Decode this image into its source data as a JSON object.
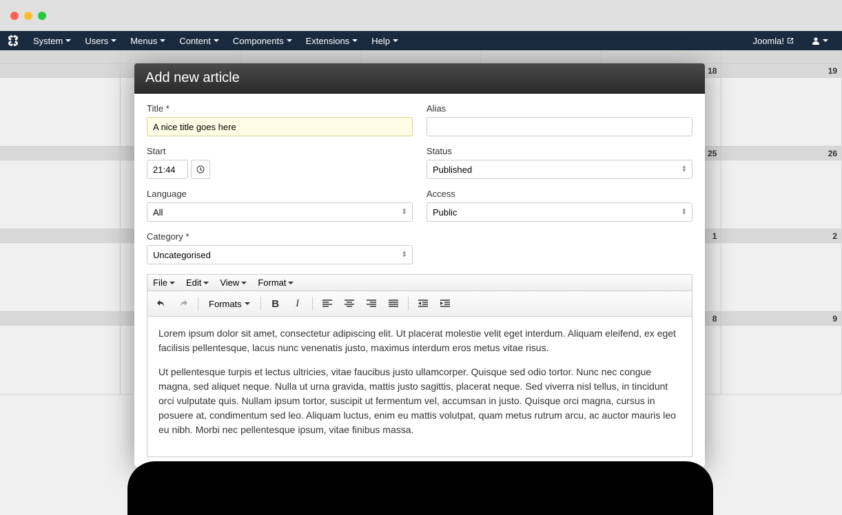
{
  "nav": {
    "items": [
      "System",
      "Users",
      "Menus",
      "Content",
      "Components",
      "Extensions",
      "Help"
    ],
    "brand": "Joomla!"
  },
  "calendar": {
    "rows": [
      [
        "",
        "",
        "",
        "",
        "",
        "",
        ""
      ],
      [
        "",
        "",
        "",
        "",
        "",
        "18",
        "19"
      ],
      [
        "",
        "",
        "",
        "",
        "",
        "25",
        "26"
      ],
      [
        "",
        "",
        "",
        "",
        "",
        "1",
        "2"
      ],
      [
        "",
        "",
        "",
        "",
        "",
        "8",
        "9"
      ]
    ]
  },
  "modal": {
    "title": "Add new article",
    "fields": {
      "title_label": "Title *",
      "title_value": "A nice title goes here",
      "alias_label": "Alias",
      "alias_value": "",
      "start_label": "Start",
      "start_value": "21:44",
      "status_label": "Status",
      "status_value": "Published",
      "language_label": "Language",
      "language_value": "All",
      "access_label": "Access",
      "access_value": "Public",
      "category_label": "Category *",
      "category_value": "Uncategorised"
    },
    "editor": {
      "menus": [
        "File",
        "Edit",
        "View",
        "Format"
      ],
      "formats_label": "Formats",
      "para1": "Lorem ipsum dolor sit amet, consectetur adipiscing elit. Ut placerat molestie velit eget interdum. Aliquam eleifend, ex eget facilisis pellentesque, lacus nunc venenatis justo, maximus interdum eros metus vitae risus.",
      "para2": "Ut pellentesque turpis et lectus ultricies, vitae faucibus justo ullamcorper. Quisque sed odio tortor. Nunc nec congue magna, sed aliquet neque. Nulla ut urna gravida, mattis justo sagittis, placerat neque. Sed viverra nisl tellus, in tincidunt orci vulputate quis. Nullam ipsum tortor, suscipit ut fermentum vel, accumsan in justo. Quisque orci magna, cursus in posuere at, condimentum sed leo. Aliquam luctus, enim eu mattis volutpat, quam metus rutrum arcu, ac auctor mauris leo eu nibh. Morbi nec pellentesque ipsum, vitae finibus massa."
    }
  }
}
